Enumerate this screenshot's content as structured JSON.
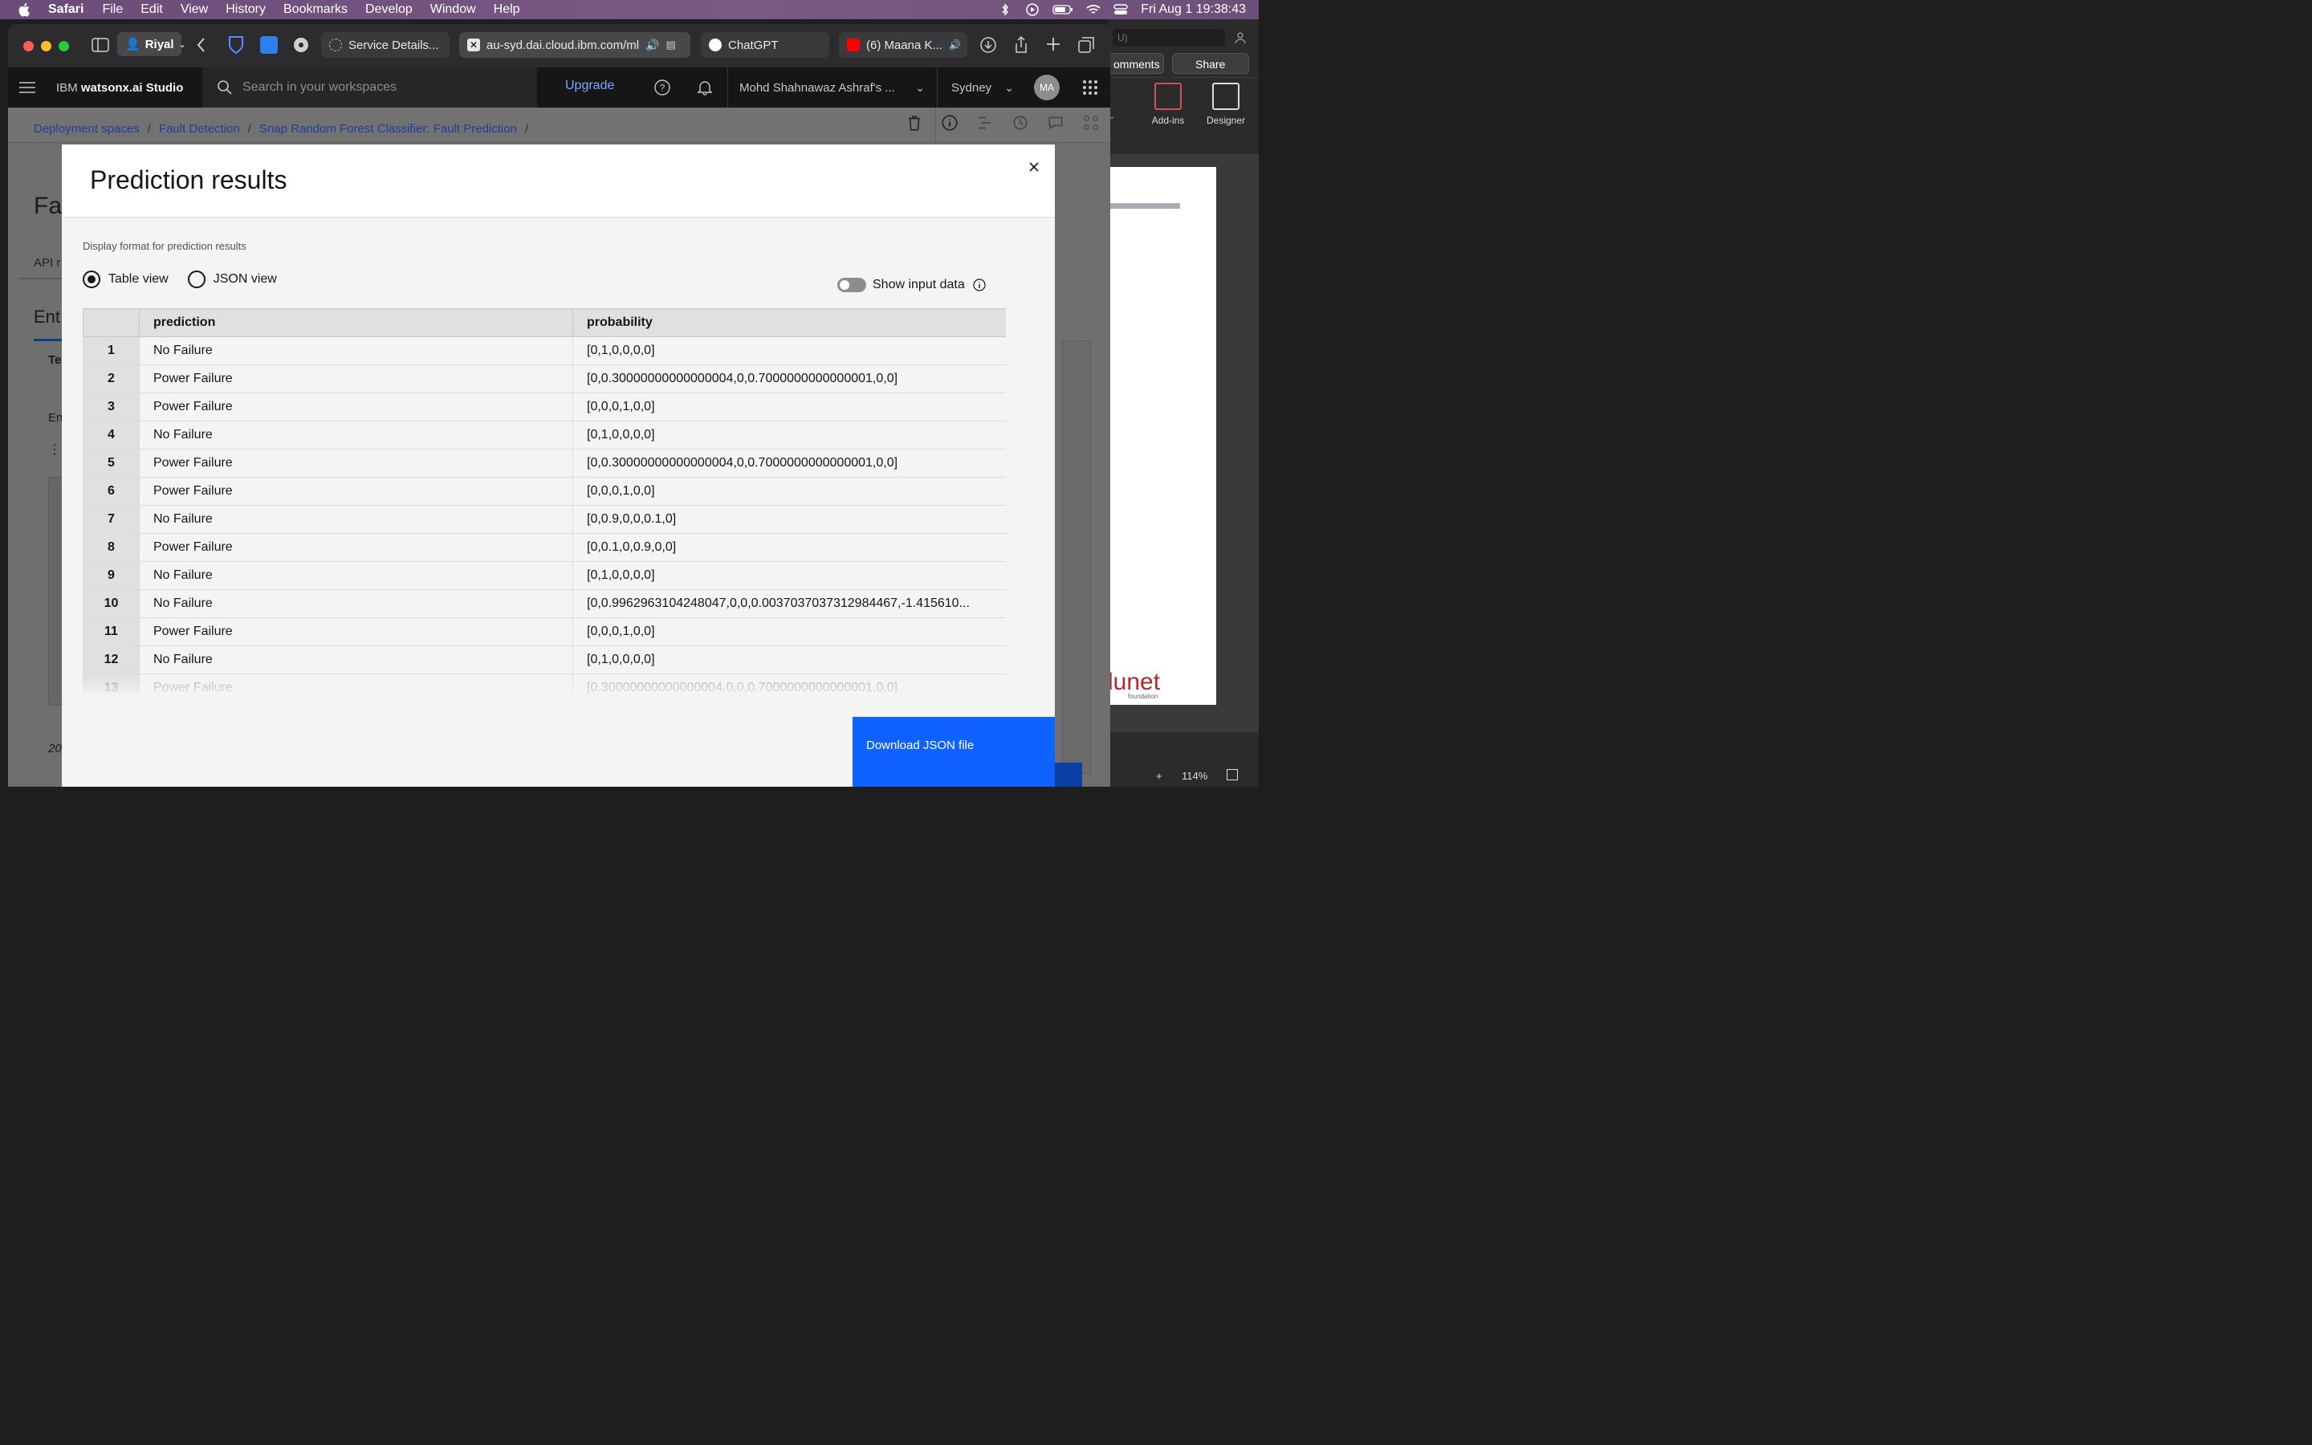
{
  "menubar": {
    "app": "Safari",
    "items": [
      "File",
      "Edit",
      "View",
      "History",
      "Bookmarks",
      "Develop",
      "Window",
      "Help"
    ],
    "clock": "Fri Aug 1  19:38:43"
  },
  "safari": {
    "profile": "Riyal",
    "tabs": [
      {
        "label": "Service Details..."
      },
      {
        "label": "au-syd.dai.cloud.ibm.com/ml"
      },
      {
        "label": "ChatGPT"
      },
      {
        "label": "(6) Maana K..."
      }
    ]
  },
  "ibm": {
    "product_prefix": "IBM ",
    "product_name": "watsonx.ai Studio",
    "search_placeholder": "Search in your workspaces",
    "upgrade": "Upgrade",
    "account": "Mohd Shahnawaz Ashraf's ...",
    "region": "Sydney",
    "avatar": "MA"
  },
  "breadcrumb": {
    "items": [
      "Deployment spaces",
      "Fault Detection",
      "Snap Random Forest Classifier: Fault Prediction"
    ],
    "separator": "/"
  },
  "background": {
    "title_fragment": "Fa",
    "tab_fragment": "API r",
    "section_fragment": "Ent",
    "te_fragment": "Te",
    "en_fragment": "En",
    "year_fragment": "20"
  },
  "word": {
    "search_fragment": "U)",
    "comments": "omments",
    "share": "Share",
    "addins": "Add-ins",
    "designer": "Designer",
    "logo": "lunet",
    "logo_sub": "foundation",
    "zoom": "114%"
  },
  "modal": {
    "title": "Prediction results",
    "format_label": "Display format for prediction results",
    "radio_table": "Table view",
    "radio_json": "JSON view",
    "selected_view": "Table view",
    "toggle_label": "Show input data",
    "toggle_on": false,
    "download": "Download JSON file",
    "columns": [
      "",
      "prediction",
      "probability"
    ],
    "rows": [
      {
        "n": "1",
        "prediction": "No Failure",
        "probability": "[0,1,0,0,0,0]"
      },
      {
        "n": "2",
        "prediction": "Power Failure",
        "probability": "[0,0.30000000000000004,0,0.7000000000000001,0,0]"
      },
      {
        "n": "3",
        "prediction": "Power Failure",
        "probability": "[0,0,0,1,0,0]"
      },
      {
        "n": "4",
        "prediction": "No Failure",
        "probability": "[0,1,0,0,0,0]"
      },
      {
        "n": "5",
        "prediction": "Power Failure",
        "probability": "[0,0.30000000000000004,0,0.7000000000000001,0,0]"
      },
      {
        "n": "6",
        "prediction": "Power Failure",
        "probability": "[0,0,0,1,0,0]"
      },
      {
        "n": "7",
        "prediction": "No Failure",
        "probability": "[0,0.9,0,0,0.1,0]"
      },
      {
        "n": "8",
        "prediction": "Power Failure",
        "probability": "[0,0.1,0,0.9,0,0]"
      },
      {
        "n": "9",
        "prediction": "No Failure",
        "probability": "[0,1,0,0,0,0]"
      },
      {
        "n": "10",
        "prediction": "No Failure",
        "probability": "[0,0.9962963104248047,0,0,0.0037037037312984467,-1.415610..."
      },
      {
        "n": "11",
        "prediction": "Power Failure",
        "probability": "[0,0,0,1,0,0]"
      },
      {
        "n": "12",
        "prediction": "No Failure",
        "probability": "[0,1,0,0,0,0]"
      },
      {
        "n": "13",
        "prediction": "Power Failure",
        "probability": "[0.30000000000000004,0,0,0.7000000000000001,0,0]"
      }
    ]
  },
  "colors": {
    "primary": "#0f62fe",
    "link": "#78a9ff",
    "header_bg": "#161616"
  }
}
